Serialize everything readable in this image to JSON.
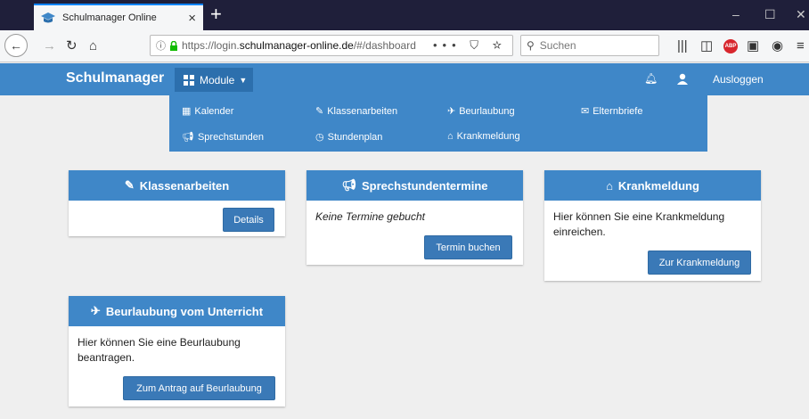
{
  "browser": {
    "tab_title": "Schulmanager Online",
    "tab_close": "×",
    "new_tab": "+",
    "url_prefix": "https://login.",
    "url_host": "schulmanager-online.de",
    "url_path": "/#/dashboard",
    "page_actions": "••• ⛉ ☆",
    "search_placeholder": "Suchen",
    "window_controls": {
      "minimize": "–",
      "maximize": "☐",
      "close": "✕"
    }
  },
  "app": {
    "brand": "Schulmanager",
    "module_button": "Module",
    "logout": "Ausloggen",
    "colors": {
      "primary": "#3f87c8",
      "button": "#3a79b7",
      "background": "#efefef"
    }
  },
  "menu": {
    "kalender": "Kalender",
    "klassenarbeiten": "Klassenarbeiten",
    "beurlaubung": "Beurlaubung",
    "elternbriefe": "Elternbriefe",
    "sprechstunden": "Sprechstunden",
    "stundenplan": "Stundenplan",
    "krankmeldung": "Krankmeldung"
  },
  "panels": {
    "klassenarbeiten": {
      "title": "Klassenarbeiten",
      "button": "Details"
    },
    "sprechstunden": {
      "title": "Sprechstundentermine",
      "text": "Keine Termine gebucht",
      "button": "Termin buchen"
    },
    "krankmeldung": {
      "title": "Krankmeldung",
      "text": "Hier können Sie eine Krankmeldung einreichen.",
      "button": "Zur Krankmeldung"
    },
    "beurlaubung": {
      "title": "Beurlaubung vom Unterricht",
      "text": "Hier können Sie eine Beurlaubung beantragen.",
      "button": "Zum Antrag auf Beurlaubung"
    }
  }
}
